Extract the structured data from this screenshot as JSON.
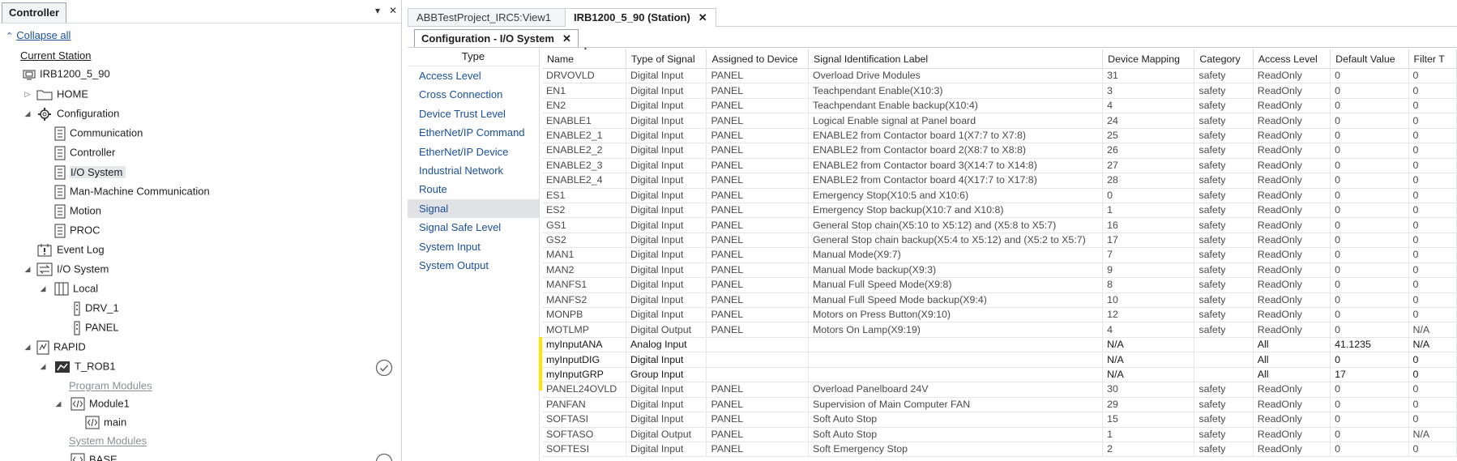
{
  "left_panel": {
    "title": "Controller",
    "pin_glyph": "▾",
    "close_glyph": "✕",
    "collapse_label": "Collapse all",
    "current_station_label": "Current Station",
    "tree": {
      "station": "IRB1200_5_90",
      "home": "HOME",
      "configuration": "Configuration",
      "communication": "Communication",
      "controller": "Controller",
      "io_system_config": "I/O System",
      "mmc": "Man-Machine Communication",
      "motion": "Motion",
      "proc": "PROC",
      "event_log": "Event Log",
      "io_system": "I/O System",
      "local": "Local",
      "drv1": "DRV_1",
      "panel": "PANEL",
      "rapid": "RAPID",
      "t_rob1": "T_ROB1",
      "program_modules": "Program Modules",
      "module1": "Module1",
      "main": "main",
      "system_modules": "System Modules",
      "base": "BASE"
    }
  },
  "doc_tabs": [
    {
      "label": "ABBTestProject_IRC5:View1"
    },
    {
      "label": "IRB1200_5_90 (Station)",
      "close": "✕"
    }
  ],
  "inner_tab": {
    "label": "Configuration - I/O System",
    "close": "✕"
  },
  "type_list": {
    "header": "Type",
    "items": [
      "Access Level",
      "Cross Connection",
      "Device Trust Level",
      "EtherNet/IP Command",
      "EtherNet/IP Device",
      "Industrial Network",
      "Route",
      "Signal",
      "Signal Safe Level",
      "System Input",
      "System Output"
    ],
    "selected": "Signal"
  },
  "grid": {
    "columns": [
      "Name",
      "Type of Signal",
      "Assigned to Device",
      "Signal Identification Label",
      "Device Mapping",
      "Category",
      "Access Level",
      "Default Value",
      "Filter T"
    ],
    "rows": [
      [
        "DRVOVLD",
        "Digital Input",
        "PANEL",
        "Overload Drive Modules",
        "31",
        "safety",
        "ReadOnly",
        "0",
        "0"
      ],
      [
        "EN1",
        "Digital Input",
        "PANEL",
        "Teachpendant  Enable(X10:3)",
        "3",
        "safety",
        "ReadOnly",
        "0",
        "0"
      ],
      [
        "EN2",
        "Digital Input",
        "PANEL",
        "Teachpendant  Enable backup(X10:4)",
        "4",
        "safety",
        "ReadOnly",
        "0",
        "0"
      ],
      [
        "ENABLE1",
        "Digital Input",
        "PANEL",
        "Logical Enable signal at Panel board",
        "24",
        "safety",
        "ReadOnly",
        "0",
        "0"
      ],
      [
        "ENABLE2_1",
        "Digital Input",
        "PANEL",
        "ENABLE2 from Contactor board 1(X7:7 to X7:8)",
        "25",
        "safety",
        "ReadOnly",
        "0",
        "0"
      ],
      [
        "ENABLE2_2",
        "Digital Input",
        "PANEL",
        "ENABLE2 from Contactor board 2(X8:7 to X8:8)",
        "26",
        "safety",
        "ReadOnly",
        "0",
        "0"
      ],
      [
        "ENABLE2_3",
        "Digital Input",
        "PANEL",
        "ENABLE2 from Contactor board 3(X14:7 to X14:8)",
        "27",
        "safety",
        "ReadOnly",
        "0",
        "0"
      ],
      [
        "ENABLE2_4",
        "Digital Input",
        "PANEL",
        "ENABLE2 from Contactor board 4(X17:7 to X17:8)",
        "28",
        "safety",
        "ReadOnly",
        "0",
        "0"
      ],
      [
        "ES1",
        "Digital Input",
        "PANEL",
        "Emergency  Stop(X10:5 and X10:6)",
        "0",
        "safety",
        "ReadOnly",
        "0",
        "0"
      ],
      [
        "ES2",
        "Digital Input",
        "PANEL",
        "Emergency  Stop backup(X10:7 and X10:8)",
        "1",
        "safety",
        "ReadOnly",
        "0",
        "0"
      ],
      [
        "GS1",
        "Digital Input",
        "PANEL",
        "General Stop chain(X5:10 to X5:12) and (X5:8 to X5:7)",
        "16",
        "safety",
        "ReadOnly",
        "0",
        "0"
      ],
      [
        "GS2",
        "Digital Input",
        "PANEL",
        "General Stop chain backup(X5:4 to X5:12) and (X5:2 to X5:7)",
        "17",
        "safety",
        "ReadOnly",
        "0",
        "0"
      ],
      [
        "MAN1",
        "Digital Input",
        "PANEL",
        "Manual Mode(X9:7)",
        "7",
        "safety",
        "ReadOnly",
        "0",
        "0"
      ],
      [
        "MAN2",
        "Digital Input",
        "PANEL",
        "Manual Mode backup(X9:3)",
        "9",
        "safety",
        "ReadOnly",
        "0",
        "0"
      ],
      [
        "MANFS1",
        "Digital Input",
        "PANEL",
        "Manual Full Speed Mode(X9:8)",
        "8",
        "safety",
        "ReadOnly",
        "0",
        "0"
      ],
      [
        "MANFS2",
        "Digital Input",
        "PANEL",
        "Manual Full Speed Mode backup(X9:4)",
        "10",
        "safety",
        "ReadOnly",
        "0",
        "0"
      ],
      [
        "MONPB",
        "Digital Input",
        "PANEL",
        "Motors on Press Button(X9:10)",
        "12",
        "safety",
        "ReadOnly",
        "0",
        "0"
      ],
      [
        "MOTLMP",
        "Digital Output",
        "PANEL",
        "Motors On Lamp(X9:19)",
        "4",
        "safety",
        "ReadOnly",
        "0",
        "N/A"
      ],
      [
        "myInputANA",
        "Analog Input",
        "",
        "",
        "N/A",
        "",
        "All",
        "41.1235",
        "N/A"
      ],
      [
        "myInputDIG",
        "Digital Input",
        "",
        "",
        "N/A",
        "",
        "All",
        "0",
        "0"
      ],
      [
        "myInputGRP",
        "Group Input",
        "",
        "",
        "N/A",
        "",
        "All",
        "17",
        "0"
      ],
      [
        "PANEL24OVLD",
        "Digital Input",
        "PANEL",
        "Overload Panelboard 24V",
        "30",
        "safety",
        "ReadOnly",
        "0",
        "0"
      ],
      [
        "PANFAN",
        "Digital Input",
        "PANEL",
        "Supervision of Main Computer FAN",
        "29",
        "safety",
        "ReadOnly",
        "0",
        "0"
      ],
      [
        "SOFTASI",
        "Digital Input",
        "PANEL",
        "Soft Auto Stop",
        "15",
        "safety",
        "ReadOnly",
        "0",
        "0"
      ],
      [
        "SOFTASO",
        "Digital Output",
        "PANEL",
        "Soft Auto Stop",
        "1",
        "safety",
        "ReadOnly",
        "0",
        "N/A"
      ],
      [
        "SOFTESI",
        "Digital Input",
        "PANEL",
        "Soft Emergency Stop",
        "2",
        "safety",
        "ReadOnly",
        "0",
        "0"
      ]
    ],
    "highlight_color": "#ffe600"
  },
  "colors": {
    "link": "#1a4f9c",
    "selected_bg": "#e3e6ea",
    "border": "#c9ced6"
  }
}
